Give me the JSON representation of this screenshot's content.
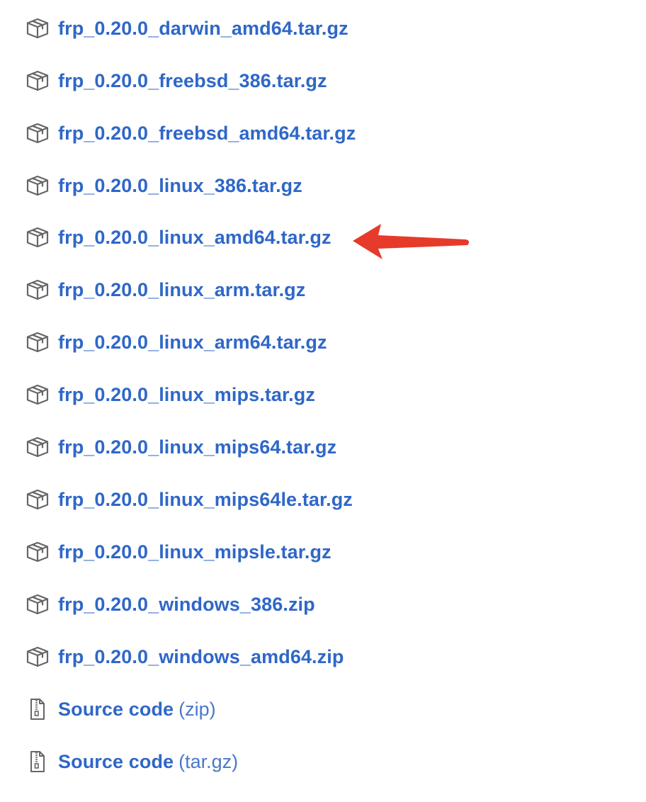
{
  "assets": [
    {
      "label": "frp_0.20.0_darwin_amd64.tar.gz",
      "icon": "package-icon"
    },
    {
      "label": "frp_0.20.0_freebsd_386.tar.gz",
      "icon": "package-icon"
    },
    {
      "label": "frp_0.20.0_freebsd_amd64.tar.gz",
      "icon": "package-icon"
    },
    {
      "label": "frp_0.20.0_linux_386.tar.gz",
      "icon": "package-icon"
    },
    {
      "label": "frp_0.20.0_linux_amd64.tar.gz",
      "icon": "package-icon"
    },
    {
      "label": "frp_0.20.0_linux_arm.tar.gz",
      "icon": "package-icon"
    },
    {
      "label": "frp_0.20.0_linux_arm64.tar.gz",
      "icon": "package-icon"
    },
    {
      "label": "frp_0.20.0_linux_mips.tar.gz",
      "icon": "package-icon"
    },
    {
      "label": "frp_0.20.0_linux_mips64.tar.gz",
      "icon": "package-icon"
    },
    {
      "label": "frp_0.20.0_linux_mips64le.tar.gz",
      "icon": "package-icon"
    },
    {
      "label": "frp_0.20.0_linux_mipsle.tar.gz",
      "icon": "package-icon"
    },
    {
      "label": "frp_0.20.0_windows_386.zip",
      "icon": "package-icon"
    },
    {
      "label": "frp_0.20.0_windows_amd64.zip",
      "icon": "package-icon"
    }
  ],
  "source_code": [
    {
      "label": "Source code",
      "format": "(zip)",
      "icon": "file-zip-icon"
    },
    {
      "label": "Source code",
      "format": "(tar.gz)",
      "icon": "file-zip-icon"
    }
  ],
  "annotation": {
    "icon": "red-arrow-icon",
    "color": "#e63a2b"
  },
  "colors": {
    "link": "#2f67c8",
    "icon": "#666666"
  }
}
